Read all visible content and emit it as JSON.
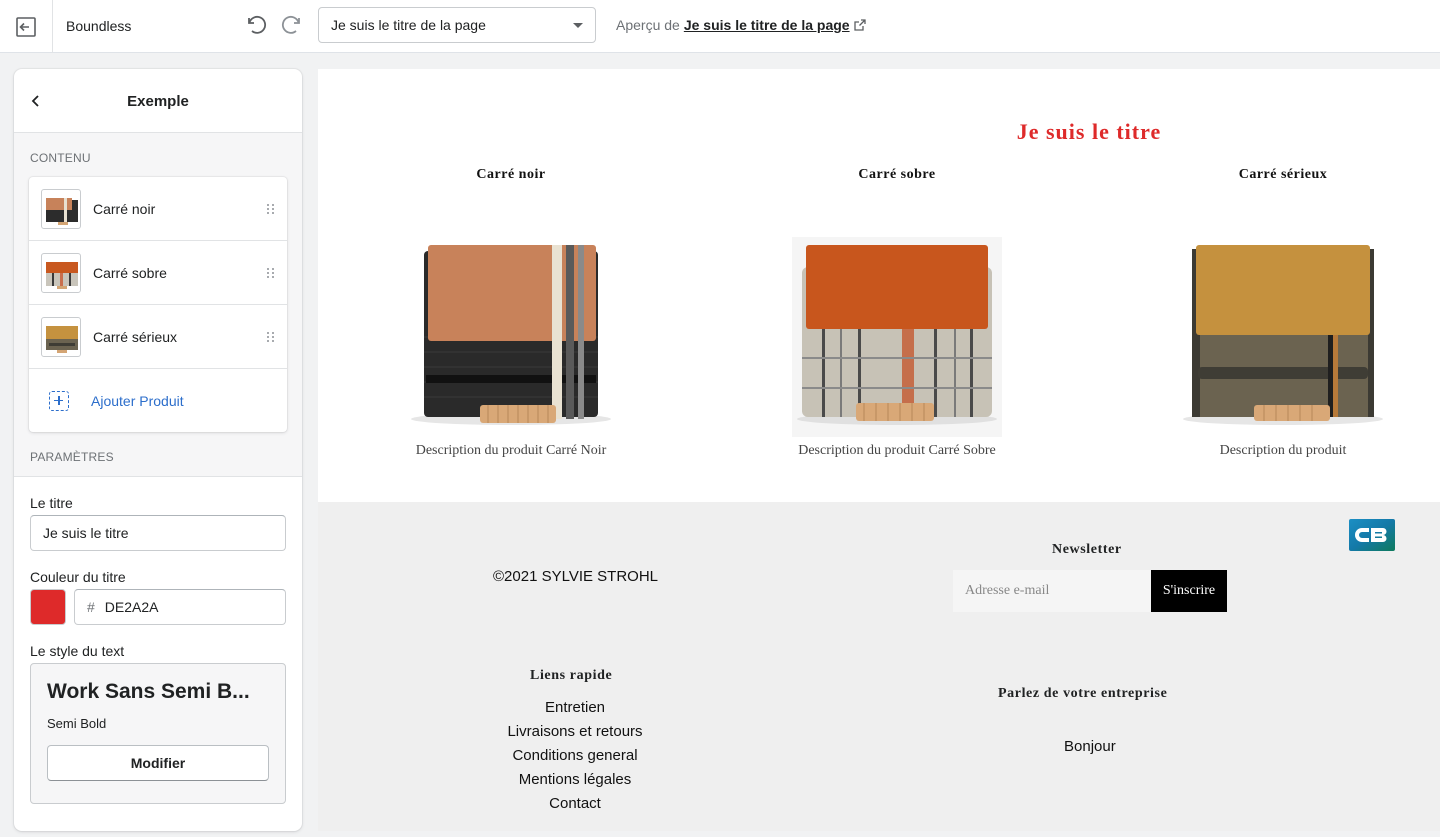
{
  "topbar": {
    "app_name": "Boundless",
    "page_select": "Je suis le titre de la page",
    "preview_prefix": "Aperçu de",
    "preview_link": "Je suis le titre de la page"
  },
  "sidebar": {
    "title": "Exemple",
    "content_label": "CONTENU",
    "blocks": [
      {
        "label": "Carré noir",
        "thumb": "black-bag"
      },
      {
        "label": "Carré sobre",
        "thumb": "orange-bag"
      },
      {
        "label": "Carré sérieux",
        "thumb": "olive-bag"
      }
    ],
    "add_label": "Ajouter Produit",
    "params_label": "PARAMÈTRES",
    "title_field_label": "Le titre",
    "title_field_value": "Je suis le titre",
    "color_field_label": "Couleur du titre",
    "color_hash": "#",
    "color_value": "DE2A2A",
    "color_hex": "#de2a2a",
    "style_field_label": "Le style du text",
    "font_name": "Work Sans Semi B...",
    "font_weight": "Semi Bold",
    "font_button": "Modifier"
  },
  "preview": {
    "collection_title": "Je suis le titre",
    "title_color": "#de2a2a",
    "products": [
      {
        "title": "Carré noir",
        "description": "Description du produit Carré Noir"
      },
      {
        "title": "Carré sobre",
        "description": "Description du produit Carré Sobre"
      },
      {
        "title": "Carré sérieux",
        "description": "Description du produit"
      }
    ],
    "footer": {
      "copyright": "©2021 SYLVIE STROHL",
      "newsletter_title": "Newsletter",
      "email_placeholder": "Adresse e-mail",
      "subscribe": "S'inscrire",
      "links_title": "Liens rapide",
      "links": [
        "Entretien",
        "Livraisons et retours",
        "Conditions general",
        "Mentions légales",
        "Contact"
      ],
      "biz_title": "Parlez de votre entreprise",
      "biz_text": "Bonjour",
      "payment_logo": "cb-logo"
    }
  }
}
